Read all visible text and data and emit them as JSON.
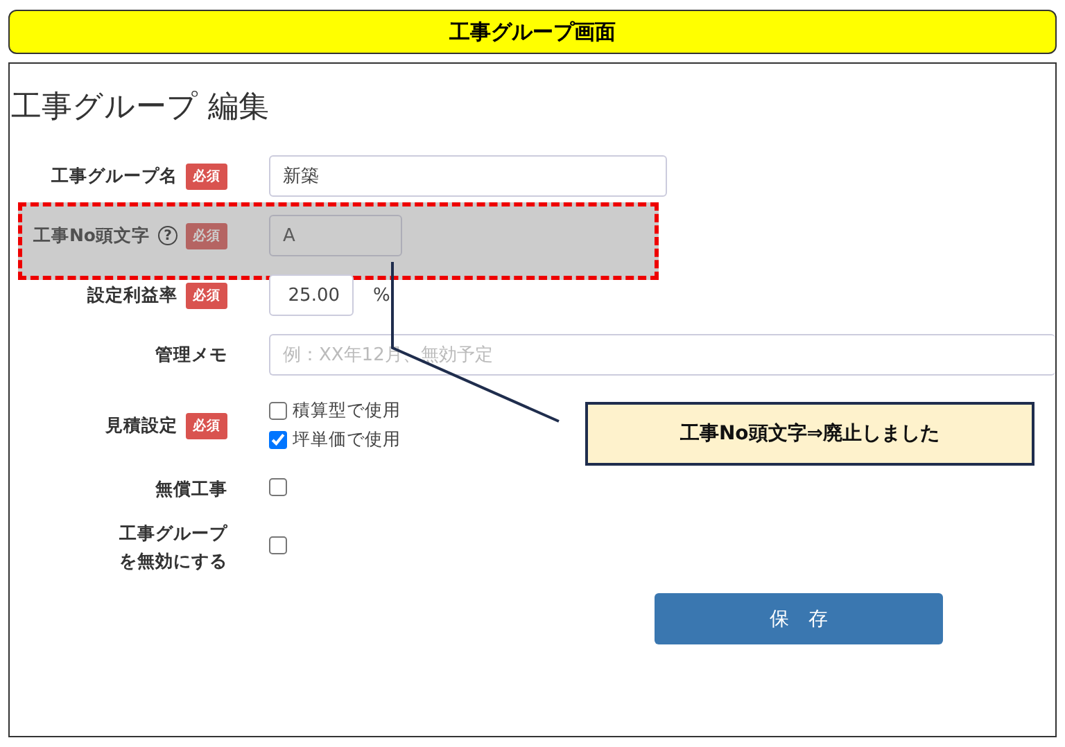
{
  "banner": {
    "title": "工事グループ画面"
  },
  "heading": "工事グループ 編集",
  "fields": [
    {
      "kind": "text",
      "label": "工事グループ名",
      "badge": "必須",
      "value": "新築"
    },
    {
      "kind": "text",
      "label": "工事No頭文字",
      "help": "?",
      "badge": "必須",
      "value": "A",
      "deprecated": true
    },
    {
      "kind": "number",
      "label": "設定利益率",
      "badge": "必須",
      "value": "25.00",
      "unit": "%"
    },
    {
      "kind": "text",
      "label": "管理メモ",
      "placeholder": "例：XX年12月、無効予定"
    },
    {
      "kind": "checks",
      "label": "見積設定",
      "badge": "必須",
      "options": [
        {
          "label": "積算型で使用",
          "checked": false
        },
        {
          "label": "坪単価で使用",
          "checked": true
        }
      ]
    },
    {
      "kind": "check",
      "label": "無償工事",
      "checked": false
    },
    {
      "kind": "check",
      "label_lines": [
        "工事グループ",
        "を無効にする"
      ],
      "checked": false
    }
  ],
  "save_button": "保　存",
  "callout": {
    "text": "工事No頭文字⇒廃止しました"
  }
}
